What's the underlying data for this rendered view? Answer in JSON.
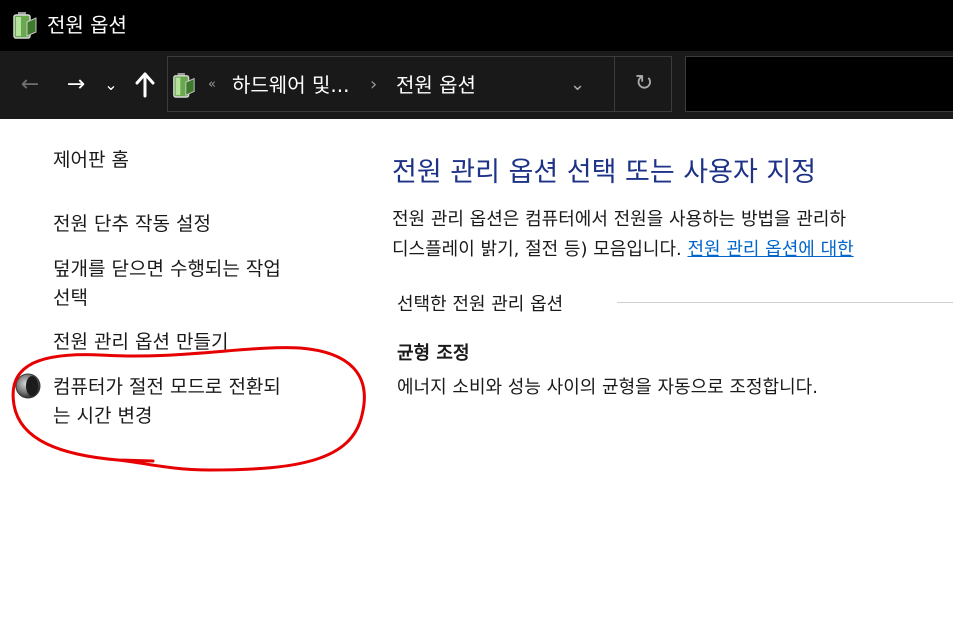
{
  "window": {
    "title": "전원 옵션"
  },
  "navigation": {
    "back_icon": "←",
    "forward_icon": "→",
    "recent_icon": "⌄",
    "up_icon": "🡑"
  },
  "address": {
    "overflow_icon": "«",
    "crumbs": [
      "하드웨어 및...",
      "전원 옵션"
    ],
    "separator_icon": "›",
    "dropdown_icon": "⌄",
    "refresh_icon": "↻"
  },
  "sidebar": {
    "items": [
      {
        "label": "제어판 홈"
      },
      {
        "label": "전원 단추 작동 설정"
      },
      {
        "line1": "덮개를 닫으면 수행되는 작업",
        "line2": "선택"
      },
      {
        "label": "전원 관리 옵션 만들기"
      },
      {
        "line1": "컴퓨터가 절전 모드로 전환되",
        "line2": "는 시간 변경"
      }
    ]
  },
  "main": {
    "title": "전원 관리 옵션 선택 또는 사용자 지정",
    "description_line1": "전원 관리 옵션은 컴퓨터에서 전원을 사용하는 방법을 관리하",
    "description_line2": "디스플레이 밝기, 절전 등) 모음입니다. ",
    "description_link": "전원 관리 옵션에 대한",
    "section_header": "선택한 전원 관리 옵션",
    "plan_name": "균형 조정",
    "plan_description": "에너지 소비와 성능 사이의 균형을 자동으로 조정합니다."
  },
  "colors": {
    "titlebar": "#000000",
    "navbar": "#1a1a1a",
    "heading_blue": "#1e3287",
    "link_blue": "#0066cc",
    "annotation_red": "#e60000"
  }
}
